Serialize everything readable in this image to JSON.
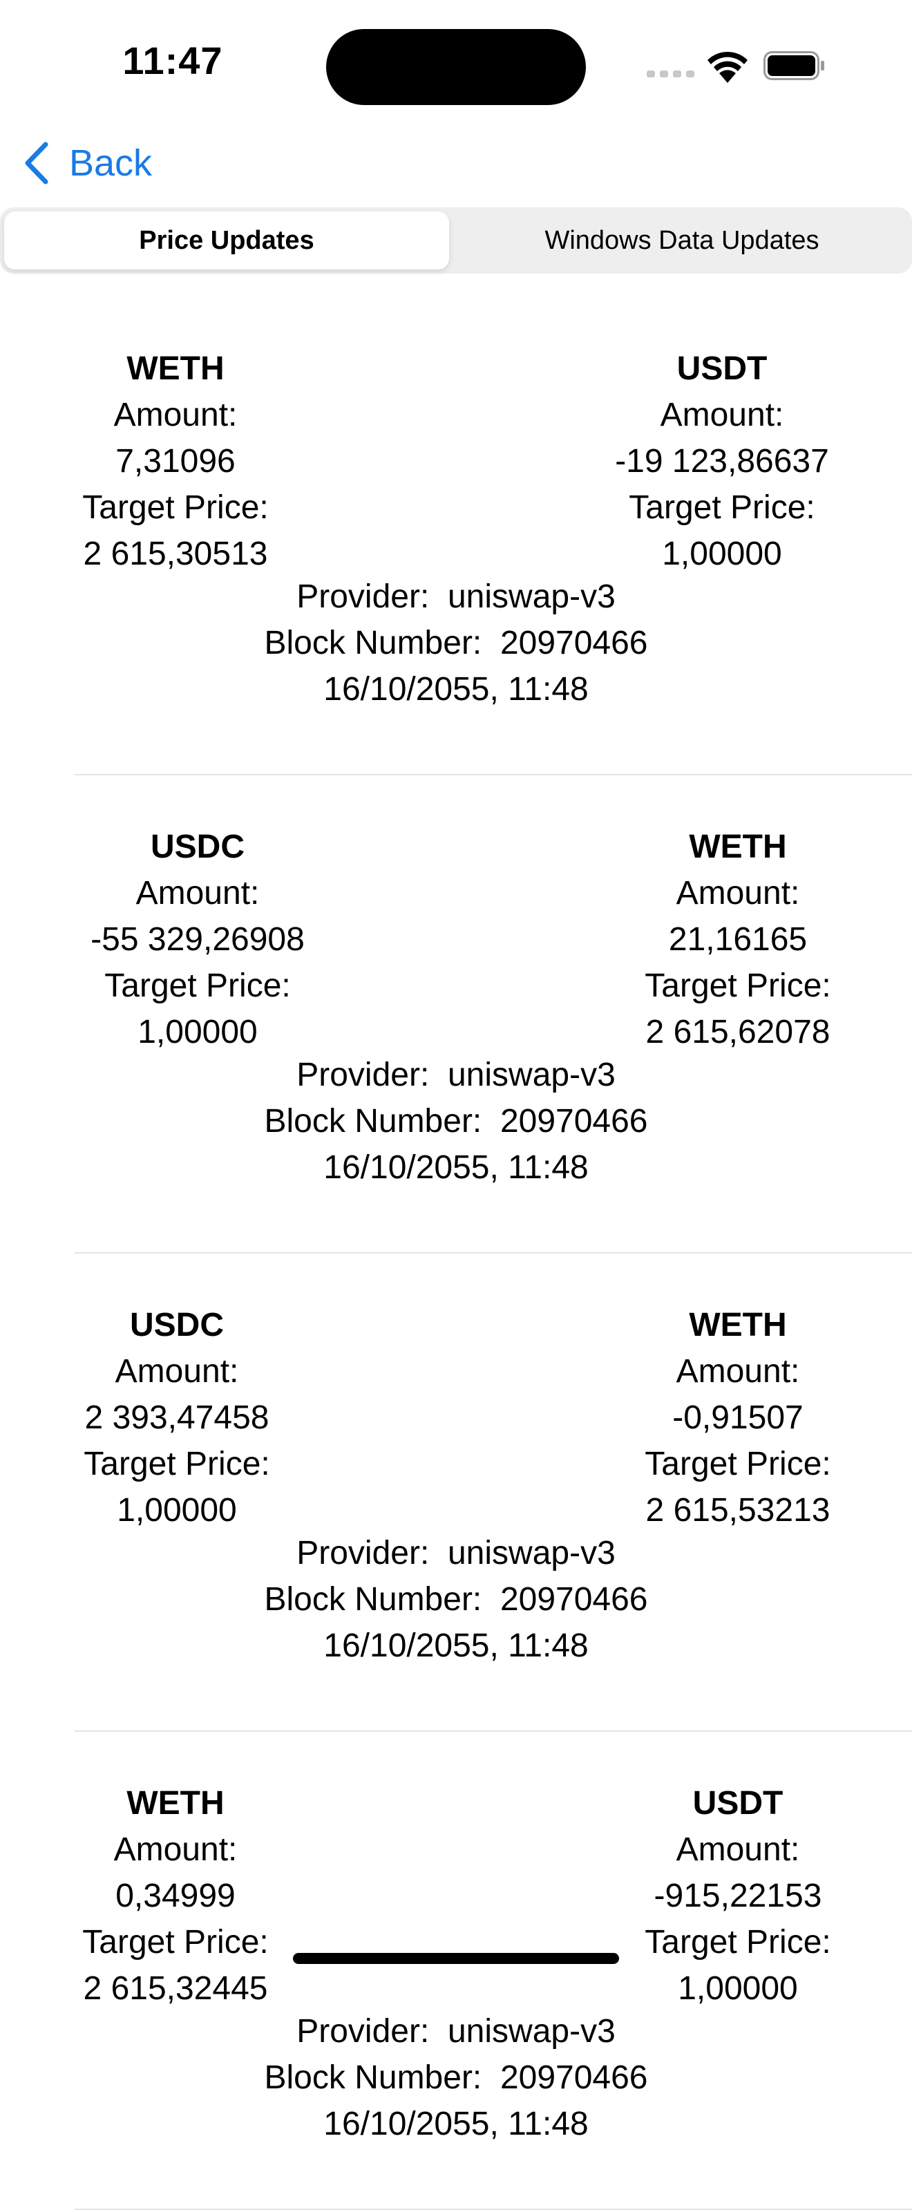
{
  "status": {
    "time": "11:47"
  },
  "nav": {
    "back_label": "Back"
  },
  "segments": {
    "left": "Price Updates",
    "right": "Windows Data Updates"
  },
  "labels": {
    "amount": "Amount:",
    "target_price": "Target Price:",
    "provider": "Provider:",
    "block_number": "Block Number:"
  },
  "updates": [
    {
      "left": {
        "symbol": "WETH",
        "amount": "7,31096",
        "target_price": "2 615,30513"
      },
      "right": {
        "symbol": "USDT",
        "amount": "-19 123,86637",
        "target_price": "1,00000"
      },
      "provider": "uniswap-v3",
      "block_number": "20970466",
      "date": "16/10/2055, 11:48"
    },
    {
      "left": {
        "symbol": "USDC",
        "amount": "-55 329,26908",
        "target_price": "1,00000"
      },
      "right": {
        "symbol": "WETH",
        "amount": "21,16165",
        "target_price": "2 615,62078"
      },
      "provider": "uniswap-v3",
      "block_number": "20970466",
      "date": "16/10/2055, 11:48"
    },
    {
      "left": {
        "symbol": "USDC",
        "amount": "2 393,47458",
        "target_price": "1,00000"
      },
      "right": {
        "symbol": "WETH",
        "amount": "-0,91507",
        "target_price": "2 615,53213"
      },
      "provider": "uniswap-v3",
      "block_number": "20970466",
      "date": "16/10/2055, 11:48"
    },
    {
      "left": {
        "symbol": "WETH",
        "amount": "0,34999",
        "target_price": "2 615,32445"
      },
      "right": {
        "symbol": "USDT",
        "amount": "-915,22153",
        "target_price": "1,00000"
      },
      "provider": "uniswap-v3",
      "block_number": "20970466",
      "date": "16/10/2055, 11:48"
    }
  ]
}
